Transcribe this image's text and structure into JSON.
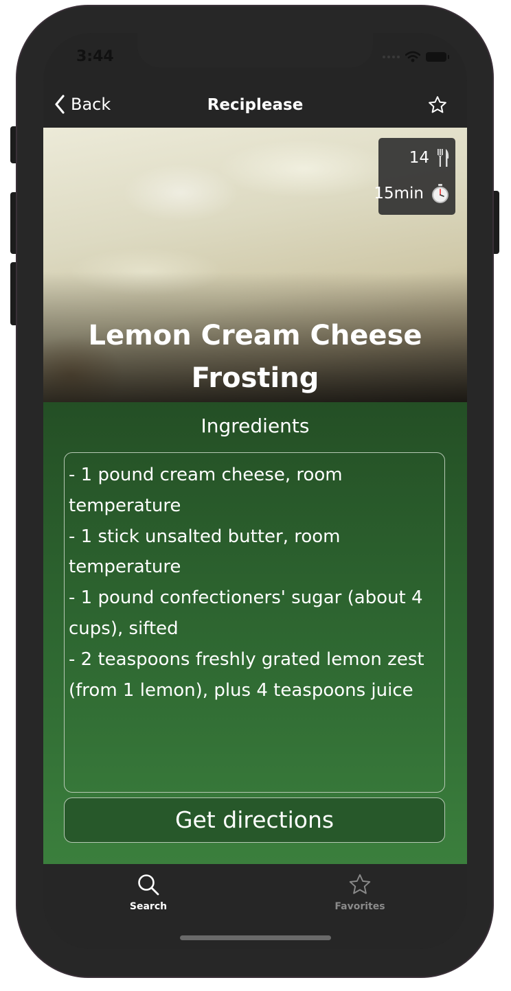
{
  "status_bar": {
    "time": "3:44"
  },
  "navbar": {
    "back_label": "Back",
    "title": "Reciplease",
    "favorite_icon": "star-outline-icon"
  },
  "recipe": {
    "title": "Lemon Cream Cheese Frosting",
    "servings": "14",
    "servings_icon": "fork-knife-icon",
    "time": "15min",
    "time_icon": "stopwatch-icon",
    "ingredients_heading": "Ingredients",
    "ingredients": [
      "- 1 pound cream cheese, room temperature",
      "- 1 stick unsalted butter, room temperature",
      "- 1 pound confectioners' sugar (about 4 cups), sifted",
      "- 2 teaspoons freshly grated lemon zest (from 1 lemon), plus 4 teaspoons juice"
    ],
    "directions_label": "Get directions"
  },
  "tabbar": {
    "tabs": [
      {
        "label": "Search",
        "icon": "search-icon",
        "selected": true
      },
      {
        "label": "Favorites",
        "icon": "star-icon",
        "selected": false
      }
    ]
  },
  "colors": {
    "background": "#252525",
    "content_green_top": "#244f25",
    "content_green_bottom": "#3b7f3d",
    "button_green": "#27582a"
  }
}
